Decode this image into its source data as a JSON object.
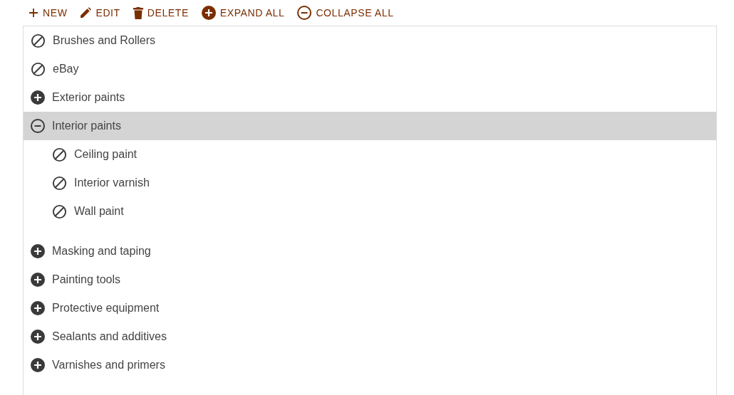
{
  "toolbar": [
    {
      "kind": "new",
      "label": "NEW"
    },
    {
      "kind": "edit",
      "label": "EDIT"
    },
    {
      "kind": "delete",
      "label": "DELETE"
    },
    {
      "kind": "expand",
      "label": "EXPAND ALL"
    },
    {
      "kind": "collapse",
      "label": "COLLAPSE ALL"
    }
  ],
  "tree": [
    {
      "label": "Brushes and Rollers",
      "kind": "leaf",
      "selected": false
    },
    {
      "label": "eBay",
      "kind": "leaf",
      "selected": false
    },
    {
      "label": "Exterior paints",
      "kind": "group",
      "expanded": false,
      "selected": false
    },
    {
      "label": "Interior paints",
      "kind": "group",
      "expanded": true,
      "selected": true,
      "children": [
        {
          "label": "Ceiling paint",
          "kind": "leaf",
          "selected": false
        },
        {
          "label": "Interior varnish",
          "kind": "leaf",
          "selected": false
        },
        {
          "label": "Wall paint",
          "kind": "leaf",
          "selected": false
        }
      ]
    },
    {
      "label": "Masking and taping",
      "kind": "group",
      "expanded": false,
      "selected": false
    },
    {
      "label": "Painting tools",
      "kind": "group",
      "expanded": false,
      "selected": false
    },
    {
      "label": "Protective equipment",
      "kind": "group",
      "expanded": false,
      "selected": false
    },
    {
      "label": "Sealants and additives",
      "kind": "group",
      "expanded": false,
      "selected": false
    },
    {
      "label": "Varnishes and primers",
      "kind": "group",
      "expanded": false,
      "selected": false
    }
  ]
}
